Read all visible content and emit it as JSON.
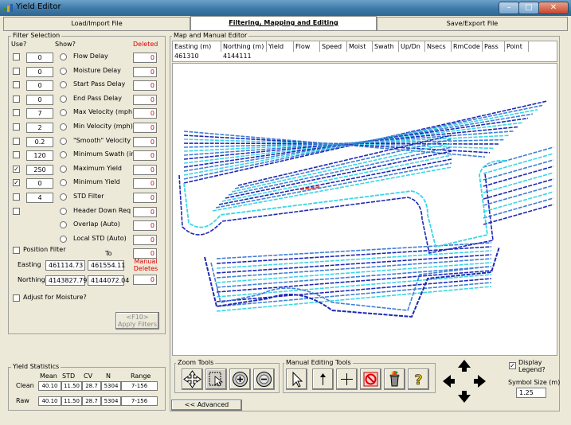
{
  "window": {
    "title": "Yield Editor"
  },
  "tabs": [
    {
      "label": "Load/Import File"
    },
    {
      "label": "Filtering, Mapping and Editing"
    },
    {
      "label": "Save/Export File"
    }
  ],
  "filter_selection": {
    "title": "Filter Selection",
    "use_header": "Use?",
    "show_header": "Show?",
    "deleted_header": "Deleted",
    "rows": [
      {
        "label": "Flow Delay",
        "value": "0",
        "checked": false,
        "deleted": "0"
      },
      {
        "label": "Moisture Delay",
        "value": "0",
        "checked": false,
        "deleted": "0"
      },
      {
        "label": "Start Pass Delay",
        "value": "0",
        "checked": false,
        "deleted": "0"
      },
      {
        "label": "End Pass Delay",
        "value": "0",
        "checked": false,
        "deleted": "0"
      },
      {
        "label": "Max Velocity (mph)",
        "value": "7",
        "checked": false,
        "deleted": "0"
      },
      {
        "label": "Min Velocity (mph)",
        "value": "2",
        "checked": false,
        "deleted": "0"
      },
      {
        "label": "\"Smooth\" Velocity",
        "value": "0.2",
        "checked": false,
        "deleted": "0"
      },
      {
        "label": "Minimum Swath (in)",
        "value": "120",
        "checked": false,
        "deleted": "0"
      },
      {
        "label": "Maximum Yield",
        "value": "250",
        "checked": true,
        "deleted": "0"
      },
      {
        "label": "Minimum Yield",
        "value": "0",
        "checked": true,
        "deleted": "0"
      },
      {
        "label": "STD Filter",
        "value": "4",
        "checked": false,
        "deleted": "0"
      },
      {
        "label": "Header Down Req",
        "value": "",
        "checked": false,
        "deleted": "0"
      },
      {
        "label": "Overlap (Auto)",
        "value": "",
        "checked": null,
        "deleted": "0"
      },
      {
        "label": "Local STD (Auto)",
        "value": "",
        "checked": null,
        "deleted": "0"
      }
    ],
    "position_filter": {
      "label": "Position Filter",
      "to_label": "To",
      "easting_label": "Easting",
      "easting_from": "461114.73",
      "easting_to": "461554.11",
      "northing_label": "Northing",
      "northing_from": "4143827.79",
      "northing_to": "4144072.04",
      "manual_deletes_label": "Manual Deletes",
      "manual_deletes": "0",
      "deleted": "0"
    },
    "adjust_moisture": "Adjust for Moisture?",
    "apply_button": "<F10>\nApply Filters"
  },
  "yield_statistics": {
    "title": "Yield Statistics",
    "columns": [
      "Mean",
      "STD",
      "CV",
      "N",
      "Range"
    ],
    "rows": [
      {
        "label": "Clean",
        "values": [
          "40.10",
          "11.50",
          "28.7",
          "5304",
          "7-156"
        ]
      },
      {
        "label": "Raw",
        "values": [
          "40.10",
          "11.50",
          "28.7",
          "5304",
          "7-156"
        ]
      }
    ]
  },
  "map_editor": {
    "title": "Map and Manual Editor",
    "columns": [
      "Easting (m)",
      "Northing (m)",
      "Yield",
      "Flow",
      "Speed",
      "Moist",
      "Swath",
      "Up/Dn",
      "Nsecs",
      "RmCode",
      "Pass",
      "Point"
    ],
    "values": [
      "461310",
      "4144111",
      "",
      "",
      "",
      "",
      "",
      "",
      "",
      "",
      "",
      ""
    ]
  },
  "zoom_tools": {
    "title": "Zoom Tools"
  },
  "manual_editing_tools": {
    "title": "Manual Editing Tools"
  },
  "advanced_button": "<< Advanced",
  "display_legend": {
    "label": "Display Legend?",
    "checked": true
  },
  "symbol_size": {
    "label": "Symbol Size (m)",
    "value": "1.25"
  },
  "colors": {
    "track_dark": "#1e28b4",
    "track_mid": "#3f7fd6",
    "track_light": "#38d6e6",
    "track_hot": "#e84a2a"
  }
}
